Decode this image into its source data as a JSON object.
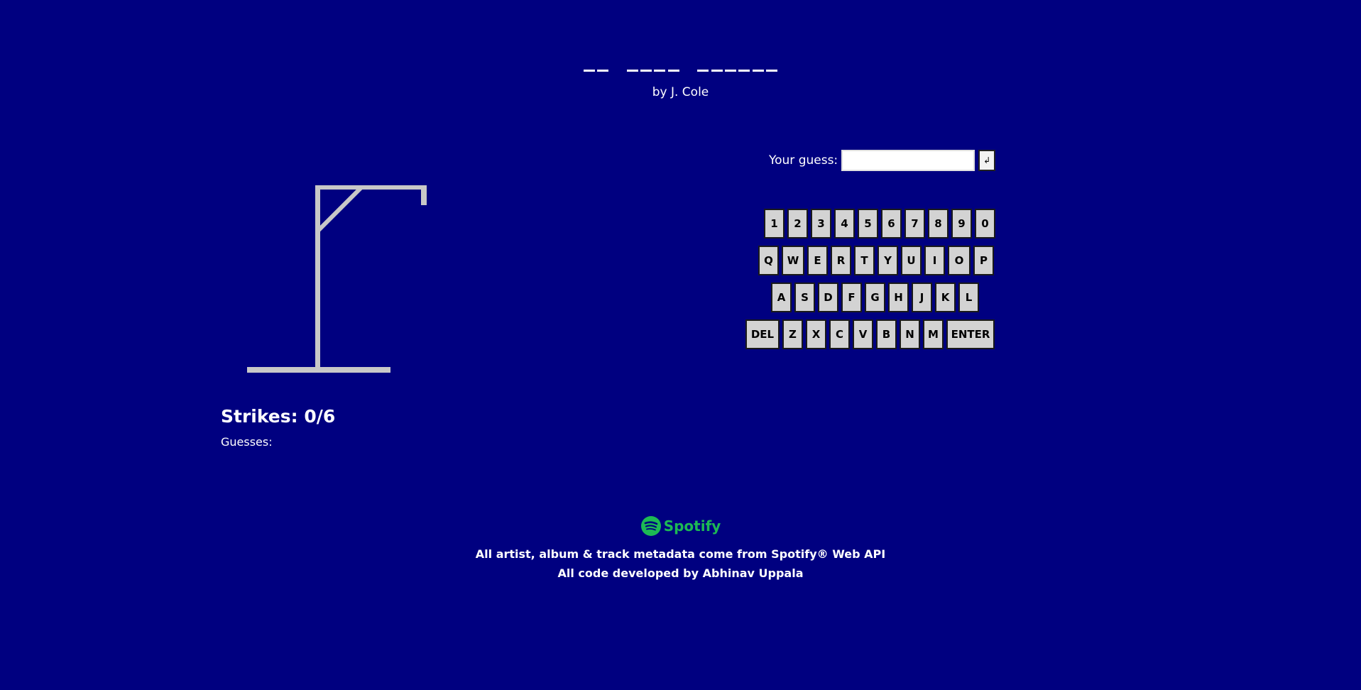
{
  "puzzle": {
    "words": [
      2,
      4,
      6
    ],
    "artist": "by J. Cole"
  },
  "game": {
    "strikes_label": "Strikes: 0/6",
    "guesses_label": "Guesses:",
    "guess_prompt": "Your guess:",
    "guess_value": "",
    "submit_icon": "↲"
  },
  "keyboard": {
    "rows": [
      [
        "1",
        "2",
        "3",
        "4",
        "5",
        "6",
        "7",
        "8",
        "9",
        "0"
      ],
      [
        "Q",
        "W",
        "E",
        "R",
        "T",
        "Y",
        "U",
        "I",
        "O",
        "P"
      ],
      [
        "A",
        "S",
        "D",
        "F",
        "G",
        "H",
        "J",
        "K",
        "L"
      ],
      [
        "DEL",
        "Z",
        "X",
        "C",
        "V",
        "B",
        "N",
        "M",
        "ENTER"
      ]
    ]
  },
  "footer": {
    "brand": "Spotify",
    "line1": "All artist, album & track metadata come from Spotify® Web API",
    "line2_prefix": "All code developed by ",
    "line2_author": "Abhinav Uppala"
  },
  "colors": {
    "background": "#000080",
    "gallows": "#c8c8c8",
    "spotify": "#1DB954",
    "key": "#d3d3d3"
  }
}
